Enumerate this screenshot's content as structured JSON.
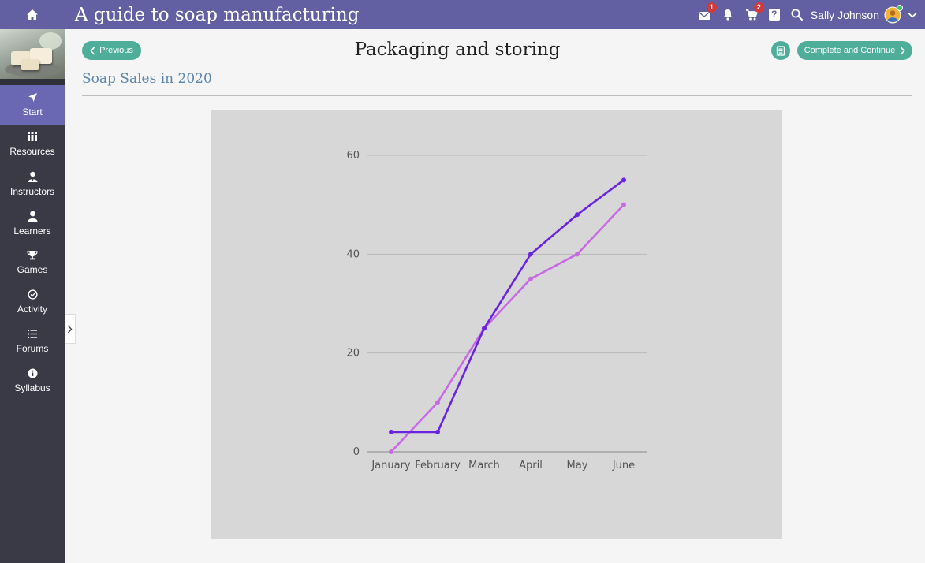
{
  "app": {
    "course_title": "A guide to soap manufacturing"
  },
  "topbar": {
    "messages_badge": "1",
    "cart_badge": "2",
    "help_label": "?",
    "user_name": "Sally Johnson"
  },
  "sidebar": {
    "items": [
      {
        "label": "Start",
        "icon": "navigation-arrow-icon",
        "active": true
      },
      {
        "label": "Resources",
        "icon": "books-icon"
      },
      {
        "label": "Instructors",
        "icon": "instructor-icon"
      },
      {
        "label": "Learners",
        "icon": "learner-icon"
      },
      {
        "label": "Games",
        "icon": "trophy-icon"
      },
      {
        "label": "Activity",
        "icon": "clock-icon"
      },
      {
        "label": "Forums",
        "icon": "list-icon"
      },
      {
        "label": "Syllabus",
        "icon": "info-icon"
      }
    ]
  },
  "header": {
    "previous_label": "Previous",
    "page_title": "Packaging and storing",
    "next_label": "Complete and Continue"
  },
  "section": {
    "title": "Soap Sales in 2020"
  },
  "colors": {
    "topbar": "#6260a3",
    "sidebar": "#393a45",
    "accent": "#4fae9a",
    "series_a": "#6a24e0",
    "series_b": "#c86ae6"
  },
  "chart_data": {
    "type": "line",
    "categories": [
      "January",
      "February",
      "March",
      "April",
      "May",
      "June"
    ],
    "series": [
      {
        "values": [
          4,
          4,
          25,
          40,
          48,
          55
        ],
        "color": "#6a24e0"
      },
      {
        "values": [
          0,
          10,
          25,
          35,
          40,
          50
        ],
        "color": "#c86ae6"
      }
    ],
    "ylim": [
      0,
      60
    ],
    "yticks": [
      0,
      20,
      40,
      60
    ],
    "grid": true
  }
}
